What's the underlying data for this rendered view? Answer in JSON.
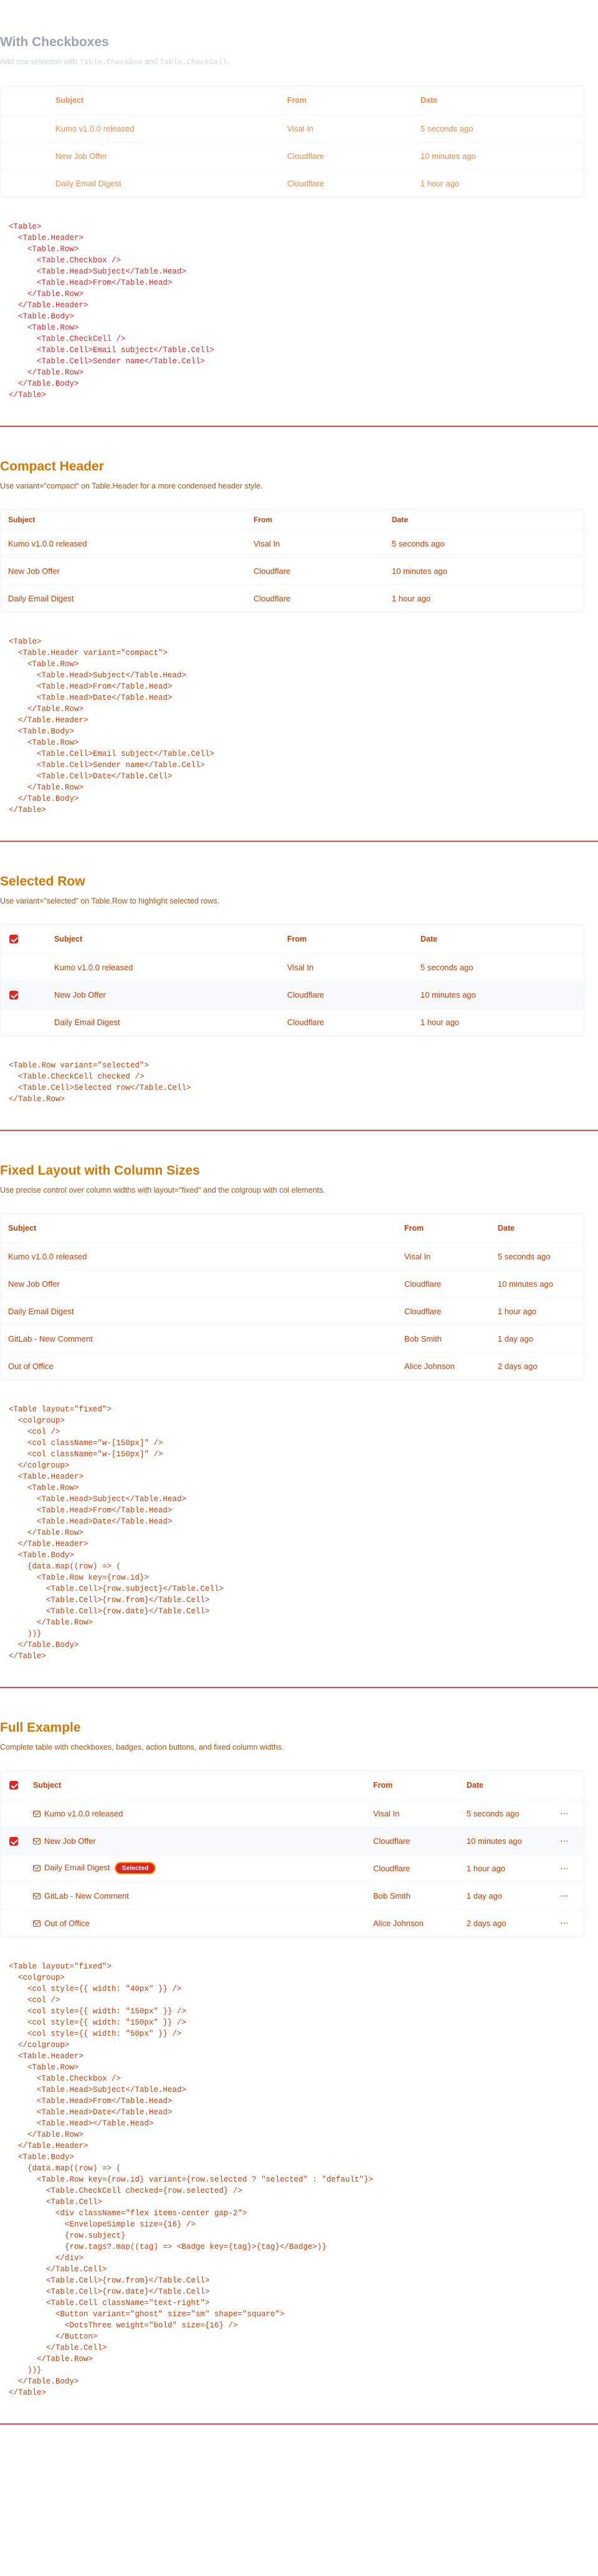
{
  "sections": {
    "checkboxes": {
      "title": "With Checkboxes",
      "desc_prefix": "Add row selection with ",
      "desc_code1": "Table.Checkbox",
      "desc_mid": " and ",
      "desc_code2": "Table.CheckCell",
      "desc_suffix": ".",
      "columns": [
        "Subject",
        "From",
        "Date"
      ],
      "rows": [
        [
          "Kumo v1.0.0 released",
          "Visal In",
          "5 seconds ago"
        ],
        [
          "New Job Offer",
          "Cloudflare",
          "10 minutes ago"
        ],
        [
          "Daily Email Digest",
          "Cloudflare",
          "1 hour ago"
        ]
      ],
      "code": "<Table>\n  <Table.Header>\n    <Table.Row>\n      <Table.Checkbox />\n      <Table.Head>Subject</Table.Head>\n      <Table.Head>From</Table.Head>\n    </Table.Row>\n  </Table.Header>\n  <Table.Body>\n    <Table.Row>\n      <Table.CheckCell />\n      <Table.Cell>Email subject</Table.Cell>\n      <Table.Cell>Sender name</Table.Cell>\n    </Table.Row>\n  </Table.Body>\n</Table>"
    },
    "compact": {
      "title": "Compact Header",
      "desc": "Use variant=\"compact\" on Table.Header for a more condensed header style.",
      "columns": [
        "Subject",
        "From",
        "Date"
      ],
      "rows": [
        [
          "Kumo v1.0.0 released",
          "Visal In",
          "5 seconds ago"
        ],
        [
          "New Job Offer",
          "Cloudflare",
          "10 minutes ago"
        ],
        [
          "Daily Email Digest",
          "Cloudflare",
          "1 hour ago"
        ]
      ],
      "code": "<Table>\n  <Table.Header variant=\"compact\">\n    <Table.Row>\n      <Table.Head>Subject</Table.Head>\n      <Table.Head>From</Table.Head>\n      <Table.Head>Date</Table.Head>\n    </Table.Row>\n  </Table.Header>\n  <Table.Body>\n    <Table.Row>\n      <Table.Cell>Email subject</Table.Cell>\n      <Table.Cell>Sender name</Table.Cell>\n      <Table.Cell>Date</Table.Cell>\n    </Table.Row>\n  </Table.Body>\n</Table>"
    },
    "selected": {
      "title": "Selected Row",
      "desc": "Use variant=\"selected\" on Table.Row to highlight selected rows.",
      "columns": [
        "Subject",
        "From",
        "Date"
      ],
      "rows": [
        [
          "Kumo v1.0.0 released",
          "Visal In",
          "5 seconds ago"
        ],
        [
          "New Job Offer",
          "Cloudflare",
          "10 minutes ago"
        ],
        [
          "Daily Email Digest",
          "Cloudflare",
          "1 hour ago"
        ]
      ],
      "code": "<Table.Row variant=\"selected\">\n  <Table.CheckCell checked />\n  <Table.Cell>Selected row</Table.Cell>\n</Table.Row>"
    },
    "fixed": {
      "title": "Fixed Layout with Column Sizes",
      "desc": "Use precise control over column widths with layout=\"fixed\" and the colgroup with col elements.",
      "columns": [
        "Subject",
        "From",
        "Date"
      ],
      "rows": [
        [
          "Kumo v1.0.0 released",
          "Visal In",
          "5 seconds ago"
        ],
        [
          "New Job Offer",
          "Cloudflare",
          "10 minutes ago"
        ],
        [
          "Daily Email Digest",
          "Cloudflare",
          "1 hour ago"
        ],
        [
          "GitLab - New Comment",
          "Bob Smith",
          "1 day ago"
        ],
        [
          "Out of Office",
          "Alice Johnson",
          "2 days ago"
        ]
      ],
      "code": "<Table layout=\"fixed\">\n  <colgroup>\n    <col />\n    <col className=\"w-[150px]\" />\n    <col className=\"w-[150px]\" />\n  </colgroup>\n  <Table.Header>\n    <Table.Row>\n      <Table.Head>Subject</Table.Head>\n      <Table.Head>From</Table.Head>\n      <Table.Head>Date</Table.Head>\n    </Table.Row>\n  </Table.Header>\n  <Table.Body>\n    {data.map((row) => (\n      <Table.Row key={row.id}>\n        <Table.Cell>{row.subject}</Table.Cell>\n        <Table.Cell>{row.from}</Table.Cell>\n        <Table.Cell>{row.date}</Table.Cell>\n      </Table.Row>\n    ))}\n  </Table.Body>\n</Table>"
    },
    "full": {
      "title": "Full Example",
      "desc": "Complete table with checkboxes, badges, action buttons, and fixed column widths.",
      "columns": [
        "Subject",
        "From",
        "Date",
        ""
      ],
      "rows": [
        [
          "Kumo v1.0.0 released",
          "Visal In",
          "5 seconds ago",
          ""
        ],
        [
          "New Job Offer",
          "Cloudflare",
          "10 minutes ago",
          ""
        ],
        [
          "Daily Email Digest",
          "Cloudflare",
          "1 hour ago",
          ""
        ],
        [
          "GitLab - New Comment",
          "Bob Smith",
          "1 day ago",
          ""
        ],
        [
          "Out of Office",
          "Alice Johnson",
          "2 days ago",
          ""
        ]
      ],
      "badge": "Selected",
      "code": "<Table layout=\"fixed\">\n  <colgroup>\n    <col style={{ width: \"40px\" }} />\n    <col />\n    <col style={{ width: \"150px\" }} />\n    <col style={{ width: \"150px\" }} />\n    <col style={{ width: \"50px\" }} />\n  </colgroup>\n  <Table.Header>\n    <Table.Row>\n      <Table.Checkbox />\n      <Table.Head>Subject</Table.Head>\n      <Table.Head>From</Table.Head>\n      <Table.Head>Date</Table.Head>\n      <Table.Head></Table.Head>\n    </Table.Row>\n  </Table.Header>\n  <Table.Body>\n    {data.map((row) => (\n      <Table.Row key={row.id} variant={row.selected ? \"selected\" : \"default\"}>\n        <Table.CheckCell checked={row.selected} />\n        <Table.Cell>\n          <div className=\"flex items-center gap-2\">\n            <EnvelopeSimple size={16} />\n            {row.subject}\n            {row.tags?.map((tag) => <Badge key={tag}>{tag}</Badge>)}\n          </div>\n        </Table.Cell>\n        <Table.Cell>{row.from}</Table.Cell>\n        <Table.Cell>{row.date}</Table.Cell>\n        <Table.Cell className=\"text-right\">\n          <Button variant=\"ghost\" size=\"sm\" shape=\"square\">\n            <DotsThree weight=\"bold\" size={16} />\n          </Button>\n        </Table.Cell>\n      </Table.Row>\n    ))}\n  </Table.Body>\n</Table>"
    }
  }
}
